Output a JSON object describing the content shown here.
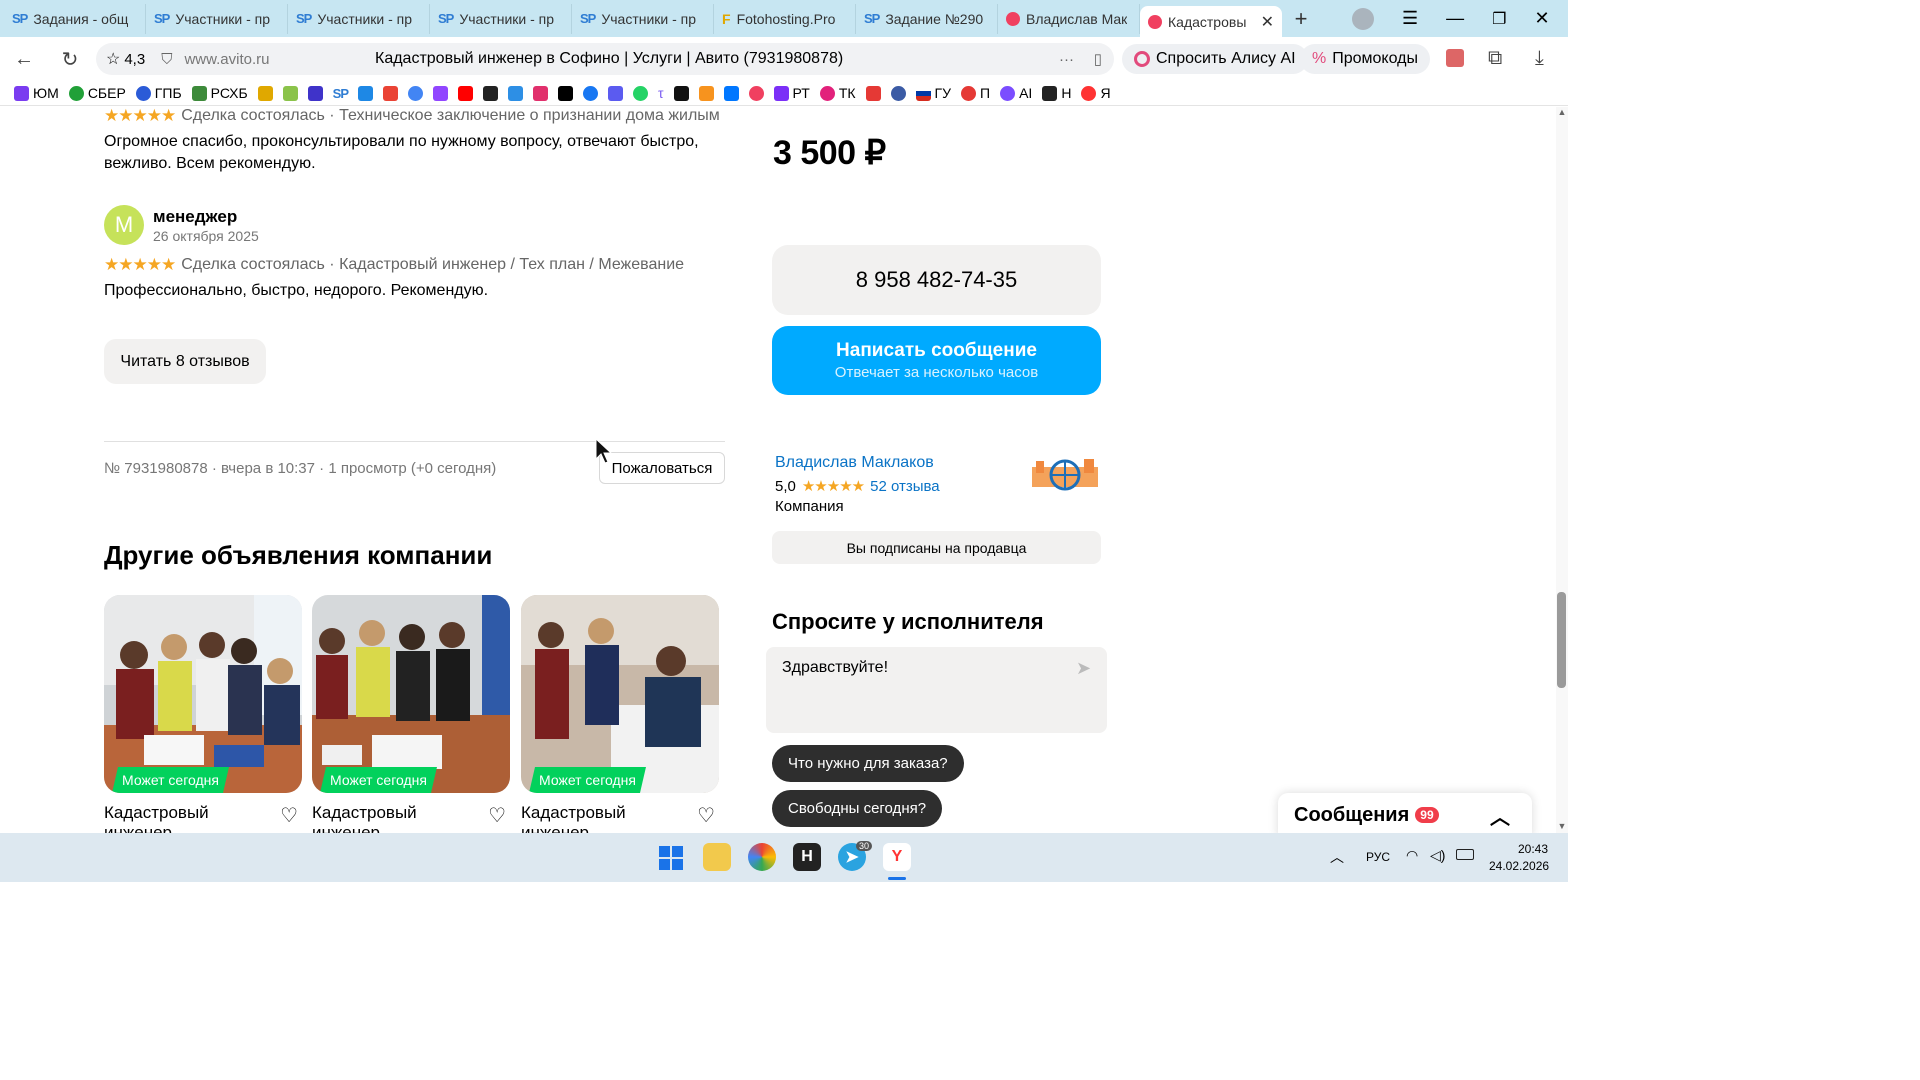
{
  "browser": {
    "tabs": [
      {
        "label": "Задания - общ",
        "icon": "SP"
      },
      {
        "label": "Участники - пр",
        "icon": "SP"
      },
      {
        "label": "Участники - пр",
        "icon": "SP"
      },
      {
        "label": "Участники - пр",
        "icon": "SP"
      },
      {
        "label": "Участники - пр",
        "icon": "SP"
      },
      {
        "label": "Fotohosting.Pro",
        "icon": "F"
      },
      {
        "label": "Задание №290",
        "icon": "SP"
      },
      {
        "label": "Владислав Мак",
        "icon": "avito"
      },
      {
        "label": "Кадастровы",
        "icon": "avito"
      }
    ],
    "rating": "4,3",
    "url": "www.avito.ru",
    "page_title": "Кадастровый инженер в Софино | Услуги | Авито (7931980878)",
    "alice_label": "Спросить Алису AI",
    "promo_label": "Промокоды",
    "bookmarks": [
      "ЮМ",
      "СБЕР",
      "ГПБ",
      "РСХБ",
      "",
      "",
      "",
      "SP",
      "",
      "",
      "",
      "",
      "",
      "",
      "",
      "",
      "",
      "",
      "",
      "",
      "",
      "",
      "",
      "",
      "РТ",
      "ТК",
      "",
      "",
      "ГУ",
      "П",
      "AI",
      "Н",
      "Я"
    ]
  },
  "reviews": [
    {
      "meta": "Сделка состоялась · Техническое заключение о признании дома жилым",
      "text": "Огромное спасибо, проконсультировали по нужному вопросу, отвечают быстро, вежливо. Всем рекомендую."
    },
    {
      "author_initial": "М",
      "author": "менеджер",
      "date": "26 октября 2025",
      "meta": "Сделка состоялась · Кадастровый инженер / Тех план / Межевание",
      "text": "Профессионально, быстро, недорого. Рекомендую."
    }
  ],
  "stars": "★★★★★",
  "read_reviews_label": "Читать 8 отзывов",
  "listing_info": "№ 7931980878 · вчера в 10:37 · 1 просмотр (+0 сегодня)",
  "complain_label": "Пожаловаться",
  "other_heading": "Другие объявления компании",
  "cards": [
    {
      "badge": "Может сегодня",
      "title": "Кадастровый инженер"
    },
    {
      "badge": "Может сегодня",
      "title": "Кадастровый инженер"
    },
    {
      "badge": "Может сегодня",
      "title": "Кадастровый инженер"
    }
  ],
  "price": "3 500 ₽",
  "phone": "8 958 482-74-35",
  "write_btn": {
    "label": "Написать сообщение",
    "sub": "Отвечает за несколько часов"
  },
  "seller": {
    "name": "Владислав Маклаков",
    "rating": "5,0",
    "reviews": "52 отзыва",
    "type": "Компания",
    "subscribed": "Вы подписаны на продавца"
  },
  "ask": {
    "heading": "Спросите у исполнителя",
    "message": "Здравствуйте!",
    "chips": [
      "Что нужно для заказа?",
      "Свободны сегодня?"
    ]
  },
  "messages": {
    "label": "Сообщения",
    "count": "99"
  },
  "taskbar": {
    "lang": "РУС",
    "time": "20:43",
    "date": "24.02.2026",
    "telegram_badge": "30"
  },
  "colors": {
    "accent": "#00aaff",
    "badge_green": "#02d15c",
    "star": "#f5a623",
    "link": "#0a73c6"
  }
}
